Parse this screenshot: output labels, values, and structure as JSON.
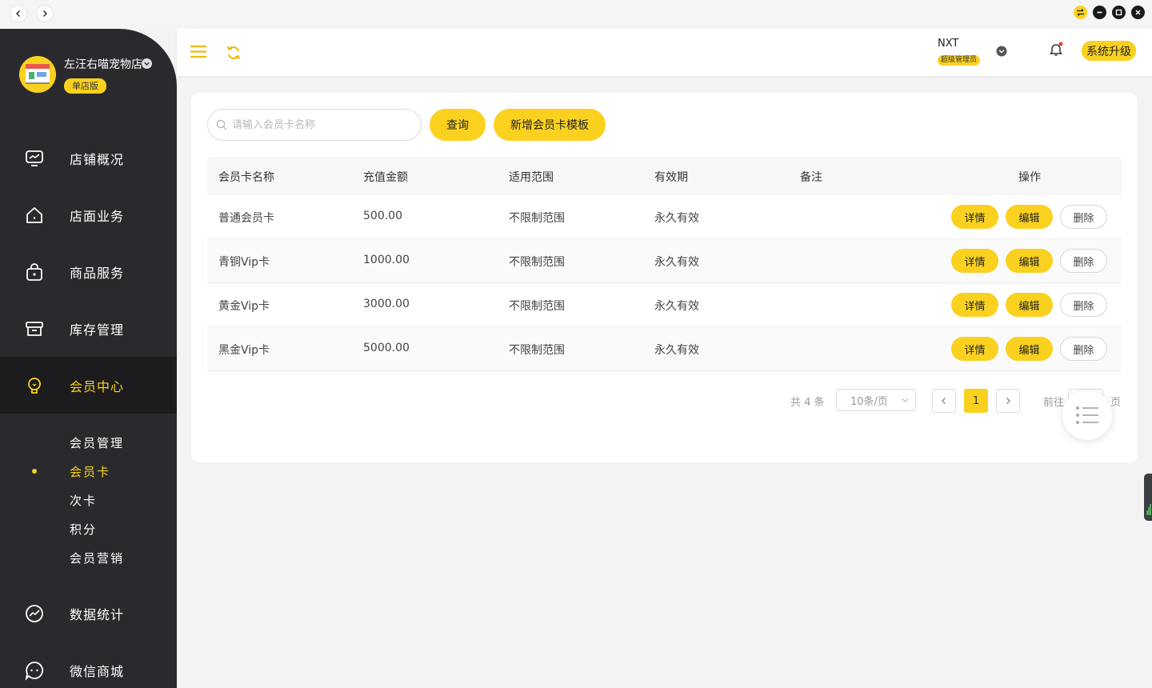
{
  "window": {
    "colors": {
      "accent": "#fad11f",
      "sidebar": "#2a2a2e"
    }
  },
  "sidebar": {
    "shop_name": "左汪右喵宠物店",
    "edition": "单店版",
    "items": [
      {
        "label": "店铺概况",
        "icon": "monitor-icon"
      },
      {
        "label": "店面业务",
        "icon": "home-icon"
      },
      {
        "label": "商品服务",
        "icon": "bag-icon"
      },
      {
        "label": "库存管理",
        "icon": "archive-box-icon"
      },
      {
        "label": "会员中心",
        "icon": "bulb-icon",
        "active": true
      },
      {
        "label": "数据统计",
        "icon": "trend-chart-icon"
      },
      {
        "label": "微信商城",
        "icon": "chat-bubble-icon"
      }
    ],
    "sub_items": [
      {
        "label": "会员管理"
      },
      {
        "label": "会员卡",
        "active": true
      },
      {
        "label": "次卡"
      },
      {
        "label": "积分"
      },
      {
        "label": "会员营销"
      }
    ]
  },
  "header": {
    "user_name": "NXT",
    "user_role": "超级管理员",
    "upgrade_label": "系统升级"
  },
  "toolbar": {
    "search_placeholder": "请输入会员卡名称",
    "query_label": "查询",
    "add_label": "新增会员卡模板"
  },
  "table": {
    "columns": [
      "会员卡名称",
      "充值金额",
      "适用范围",
      "有效期",
      "备注",
      "操作"
    ],
    "rows": [
      {
        "name": "普通会员卡",
        "amount": "500.00",
        "scope": "不限制范围",
        "validity": "永久有效",
        "note": ""
      },
      {
        "name": "青铜Vip卡",
        "amount": "1000.00",
        "scope": "不限制范围",
        "validity": "永久有效",
        "note": ""
      },
      {
        "name": "黄金Vip卡",
        "amount": "3000.00",
        "scope": "不限制范围",
        "validity": "永久有效",
        "note": ""
      },
      {
        "name": "黑金Vip卡",
        "amount": "5000.00",
        "scope": "不限制范围",
        "validity": "永久有效",
        "note": ""
      }
    ],
    "actions": {
      "detail": "详情",
      "edit": "编辑",
      "delete": "删除"
    }
  },
  "pagination": {
    "total_text": "共 4 条",
    "page_size": "10条/页",
    "current_page": "1",
    "goto_prefix": "前往",
    "goto_suffix": "页"
  }
}
